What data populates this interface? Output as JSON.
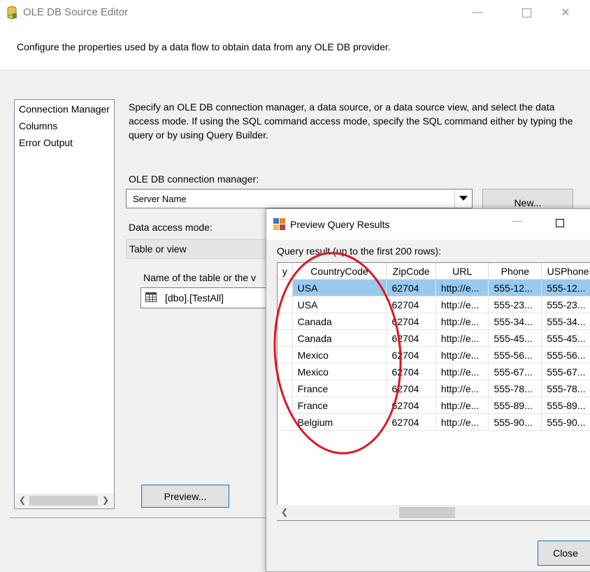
{
  "window": {
    "title": "OLE DB Source Editor",
    "description": "Configure the properties used by a data flow to obtain data from any OLE DB provider."
  },
  "nav": {
    "items": [
      "Connection Manager",
      "Columns",
      "Error Output"
    ]
  },
  "connection": {
    "info": "Specify an OLE DB connection manager, a data source, or a data source view, and select the data access mode. If using the SQL command access mode, specify the SQL command either by typing the query or by using Query Builder.",
    "manager_label": "OLE DB connection manager:",
    "manager_value": "Server Name",
    "new_label": "New...",
    "access_mode_label": "Data access mode:",
    "access_mode_value": "Table or view",
    "table_label": "Name of the table or the v",
    "table_value": "[dbo].[TestAll]",
    "preview_label": "Preview..."
  },
  "preview_dialog": {
    "title": "Preview Query Results",
    "caption": "Query result (up to the first 200 rows):",
    "columns": [
      "y",
      "CountryCode",
      "ZipCode",
      "URL",
      "Phone",
      "USPhone"
    ],
    "rows": [
      [
        "",
        "USA",
        "62704",
        "http://e...",
        "555-12...",
        "555-12..."
      ],
      [
        "",
        "USA",
        "62704",
        "http://e...",
        "555-23...",
        "555-23..."
      ],
      [
        "",
        "Canada",
        "62704",
        "http://e...",
        "555-34...",
        "555-34..."
      ],
      [
        "",
        "Canada",
        "62704",
        "http://e...",
        "555-45...",
        "555-45..."
      ],
      [
        "",
        "Mexico",
        "62704",
        "http://e...",
        "555-56...",
        "555-56..."
      ],
      [
        "",
        "Mexico",
        "62704",
        "http://e...",
        "555-67...",
        "555-67..."
      ],
      [
        "",
        "France",
        "62704",
        "http://e...",
        "555-78...",
        "555-78..."
      ],
      [
        "",
        "France",
        "62704",
        "http://e...",
        "555-89...",
        "555-89..."
      ],
      [
        "",
        "Belgium",
        "62704",
        "http://e...",
        "555-90...",
        "555-90..."
      ]
    ],
    "close_label": "Close"
  },
  "colors": {
    "selection": "#99c9ef",
    "annotation": "#e0141e",
    "accent": "#0078d7"
  }
}
